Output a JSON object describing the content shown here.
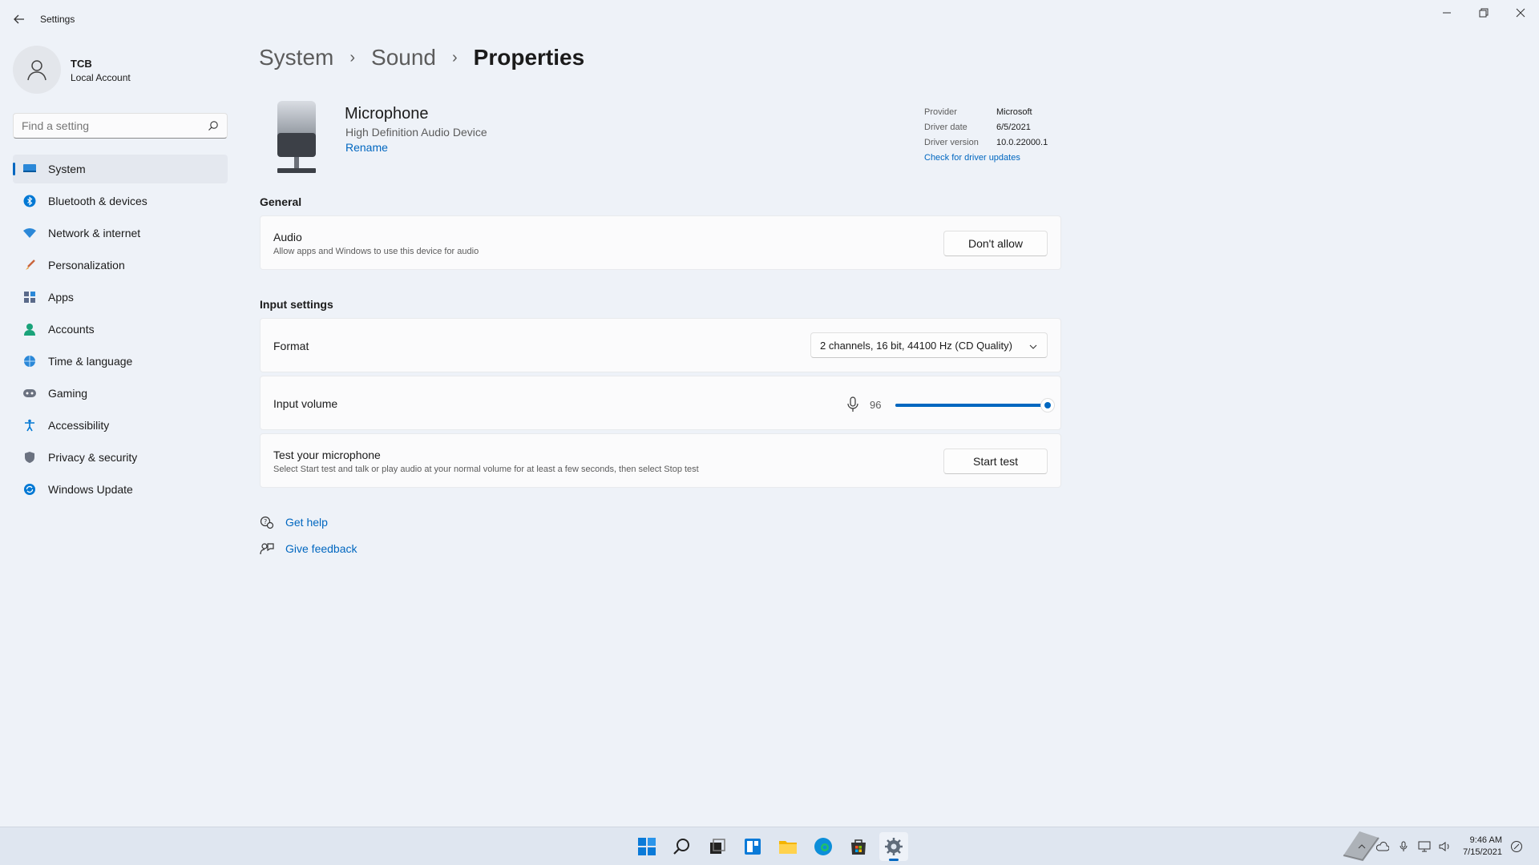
{
  "window": {
    "title": "Settings",
    "controls": [
      "minimize",
      "restore",
      "close"
    ]
  },
  "profile": {
    "name": "TCB",
    "account_type": "Local Account"
  },
  "search": {
    "placeholder": "Find a setting"
  },
  "sidebar": {
    "items": [
      {
        "label": "System",
        "icon": "system-icon",
        "active": true
      },
      {
        "label": "Bluetooth & devices",
        "icon": "bluetooth-icon"
      },
      {
        "label": "Network & internet",
        "icon": "network-icon"
      },
      {
        "label": "Personalization",
        "icon": "brush-icon"
      },
      {
        "label": "Apps",
        "icon": "apps-icon"
      },
      {
        "label": "Accounts",
        "icon": "accounts-icon"
      },
      {
        "label": "Time & language",
        "icon": "globe-icon"
      },
      {
        "label": "Gaming",
        "icon": "gamepad-icon"
      },
      {
        "label": "Accessibility",
        "icon": "accessibility-icon"
      },
      {
        "label": "Privacy & security",
        "icon": "shield-icon"
      },
      {
        "label": "Windows Update",
        "icon": "update-icon"
      }
    ]
  },
  "breadcrumb": [
    "System",
    "Sound",
    "Properties"
  ],
  "device": {
    "name": "Microphone",
    "subtitle": "High Definition Audio Device",
    "rename_label": "Rename"
  },
  "driver": {
    "provider_label": "Provider",
    "provider": "Microsoft",
    "date_label": "Driver date",
    "date": "6/5/2021",
    "version_label": "Driver version",
    "version": "10.0.22000.1",
    "update_link": "Check for driver updates"
  },
  "general": {
    "heading": "General",
    "audio_title": "Audio",
    "audio_desc": "Allow apps and Windows to use this device for audio",
    "audio_button": "Don't allow"
  },
  "input_settings": {
    "heading": "Input settings",
    "format_label": "Format",
    "format_value": "2 channels, 16 bit, 44100 Hz (CD Quality)",
    "volume_label": "Input volume",
    "volume_value": "96",
    "volume_fraction": 0.96,
    "test_title": "Test your microphone",
    "test_desc": "Select Start test and talk or play audio at your normal volume for at least a few seconds, then select Stop test",
    "test_button": "Start test"
  },
  "help": {
    "get_help": "Get help",
    "give_feedback": "Give feedback"
  },
  "taskbar": {
    "icons": [
      "start-icon",
      "search-icon",
      "task-view-icon",
      "widgets-icon",
      "file-explorer-icon",
      "edge-icon",
      "store-icon",
      "settings-icon"
    ],
    "time": "9:46 AM",
    "date": "7/15/2021"
  },
  "colors": {
    "accent": "#0067c0",
    "background": "#eef2f8",
    "card": "#fbfbfc"
  }
}
